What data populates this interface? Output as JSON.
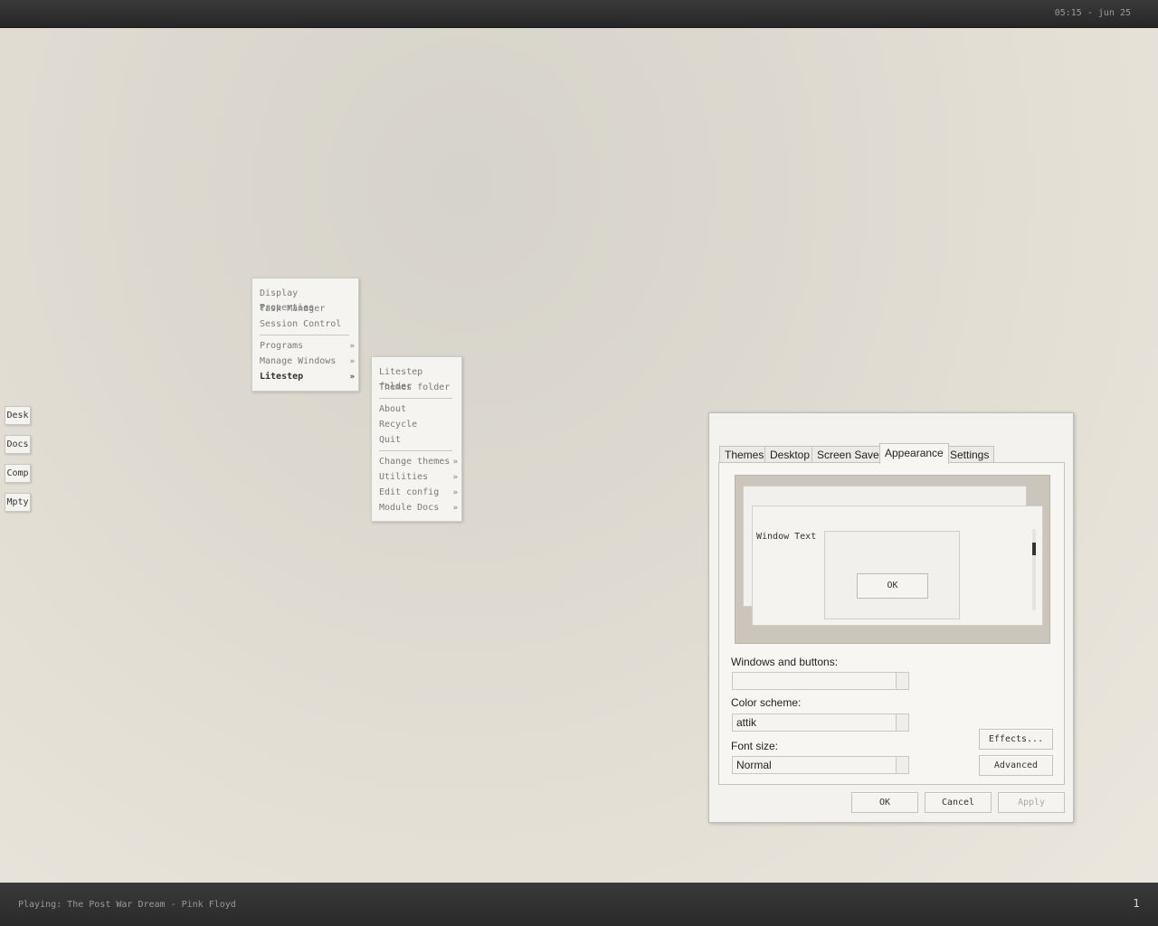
{
  "topbar": {
    "clock": "05:15 - jun 25"
  },
  "bottombar": {
    "now_playing": "Playing: The Post War Dream - Pink Floyd",
    "desktop_number": "1"
  },
  "shortcuts": [
    "Desk",
    "Docs",
    "Comp",
    "Mpty"
  ],
  "main_menu": {
    "items": [
      {
        "label": "Display Properties"
      },
      {
        "label": "Task Manager"
      },
      {
        "label": "Session Control"
      },
      {
        "label": "Programs",
        "arrow": "»"
      },
      {
        "label": "Manage Windows",
        "arrow": "»"
      },
      {
        "label": "Litestep",
        "arrow": "»",
        "active": true
      }
    ]
  },
  "litestep_menu": {
    "items": [
      {
        "label": "Litestep folder"
      },
      {
        "label": "Themes folder"
      },
      {
        "label": "About"
      },
      {
        "label": "Recycle"
      },
      {
        "label": "Quit"
      },
      {
        "label": "Change themes",
        "arrow": "»"
      },
      {
        "label": "Utilities",
        "arrow": "»"
      },
      {
        "label": "Edit config",
        "arrow": "»"
      },
      {
        "label": "Module Docs",
        "arrow": "»"
      }
    ]
  },
  "dialog": {
    "tabs": [
      "Themes",
      "Desktop",
      "Screen Saver",
      "Appearance",
      "Settings"
    ],
    "active_tab": "Appearance",
    "preview": {
      "window_text": "Window Text",
      "ok_label": "OK"
    },
    "windows_buttons_label": "Windows and buttons:",
    "windows_buttons_value": "",
    "color_scheme_label": "Color scheme:",
    "color_scheme_value": "attik",
    "font_size_label": "Font size:",
    "font_size_value": "Normal",
    "effects_label": "Effects...",
    "advanced_label": "Advanced",
    "ok_label": "OK",
    "cancel_label": "Cancel",
    "apply_label": "Apply"
  }
}
